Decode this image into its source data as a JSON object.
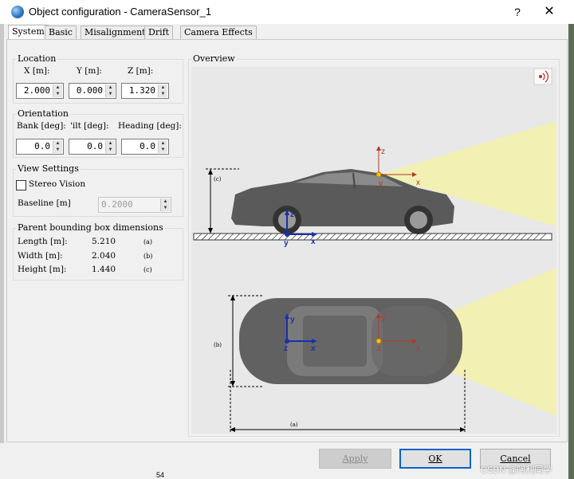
{
  "window": {
    "title": "Object configuration - CameraSensor_1",
    "help": "?",
    "close": "✕"
  },
  "tabs": [
    "System",
    "Basic",
    "Misalignment",
    "Drift",
    "Camera Effects"
  ],
  "location": {
    "title": "Location",
    "x_label": "X [m]:",
    "y_label": "Y [m]:",
    "z_label": "Z [m]:",
    "x": "2.000",
    "y": "0.000",
    "z": "1.320"
  },
  "orientation": {
    "title": "Orientation",
    "bank_label": "Bank [deg]:",
    "tilt_label": "'ilt [deg]:",
    "heading_label": "Heading [deg]:",
    "bank": "0.0",
    "tilt": "0.0",
    "heading": "0.0"
  },
  "view_settings": {
    "title": "View Settings",
    "stereo_label": "Stereo Vision",
    "stereo_checked": false,
    "baseline_label": "Baseline [m]",
    "baseline": "0.2000"
  },
  "bounding_box": {
    "title": "Parent bounding box dimensions",
    "length_label": "Length [m]:",
    "length": "5.210",
    "length_ref": "(a)",
    "width_label": "Width [m]:",
    "width": "2.040",
    "width_ref": "(b)",
    "height_label": "Height [m]:",
    "height": "1.440",
    "height_ref": "(c)"
  },
  "overview": {
    "title": "Overview",
    "side_height_ref": "(c)",
    "top_width_ref": "(b)",
    "top_length_ref": "(a)",
    "axis_x": "x",
    "axis_y": "y",
    "axis_z": "z",
    "sensor_icon": "wireless-signal-icon"
  },
  "buttons": {
    "apply": "Apply",
    "ok": "OK",
    "cancel": "Cancel"
  },
  "background": {
    "number": "54",
    "watermark": "CSDN @阿利同学"
  },
  "colors": {
    "axis_blue": "#1a2fb0",
    "axis_red": "#b0392a",
    "fov_yellow": "#f3f0b4",
    "sensor_dot": "#f5c400",
    "ok_border": "#0a64c8"
  }
}
